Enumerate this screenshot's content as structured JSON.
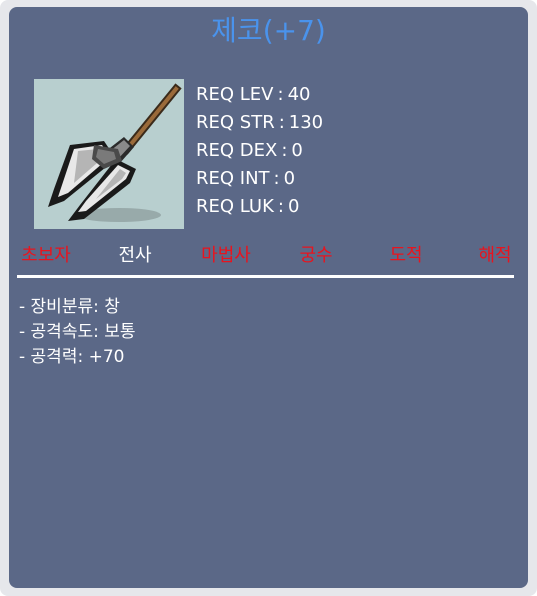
{
  "item": {
    "title": "제코(+7)",
    "icon": "halberd-spear-icon"
  },
  "requirements": [
    {
      "label": "REQ LEV",
      "value": "40"
    },
    {
      "label": "REQ STR",
      "value": "130"
    },
    {
      "label": "REQ DEX",
      "value": "0"
    },
    {
      "label": "REQ INT",
      "value": "0"
    },
    {
      "label": "REQ LUK",
      "value": "0"
    }
  ],
  "jobs": [
    {
      "name": "초보자",
      "color": "#e8141e"
    },
    {
      "name": "전사",
      "color": "#ffffff"
    },
    {
      "name": "마법사",
      "color": "#e8141e"
    },
    {
      "name": "궁수",
      "color": "#e8141e"
    },
    {
      "name": "도적",
      "color": "#e8141e"
    },
    {
      "name": "해적",
      "color": "#e8141e"
    }
  ],
  "stats": [
    "- 장비분류: 창",
    "- 공격속도: 보통",
    "- 공격력: +70"
  ],
  "colors": {
    "title": "#4a93ec",
    "panel": "#5b6887",
    "text": "#ffffff",
    "unavailable_job": "#e8141e"
  }
}
